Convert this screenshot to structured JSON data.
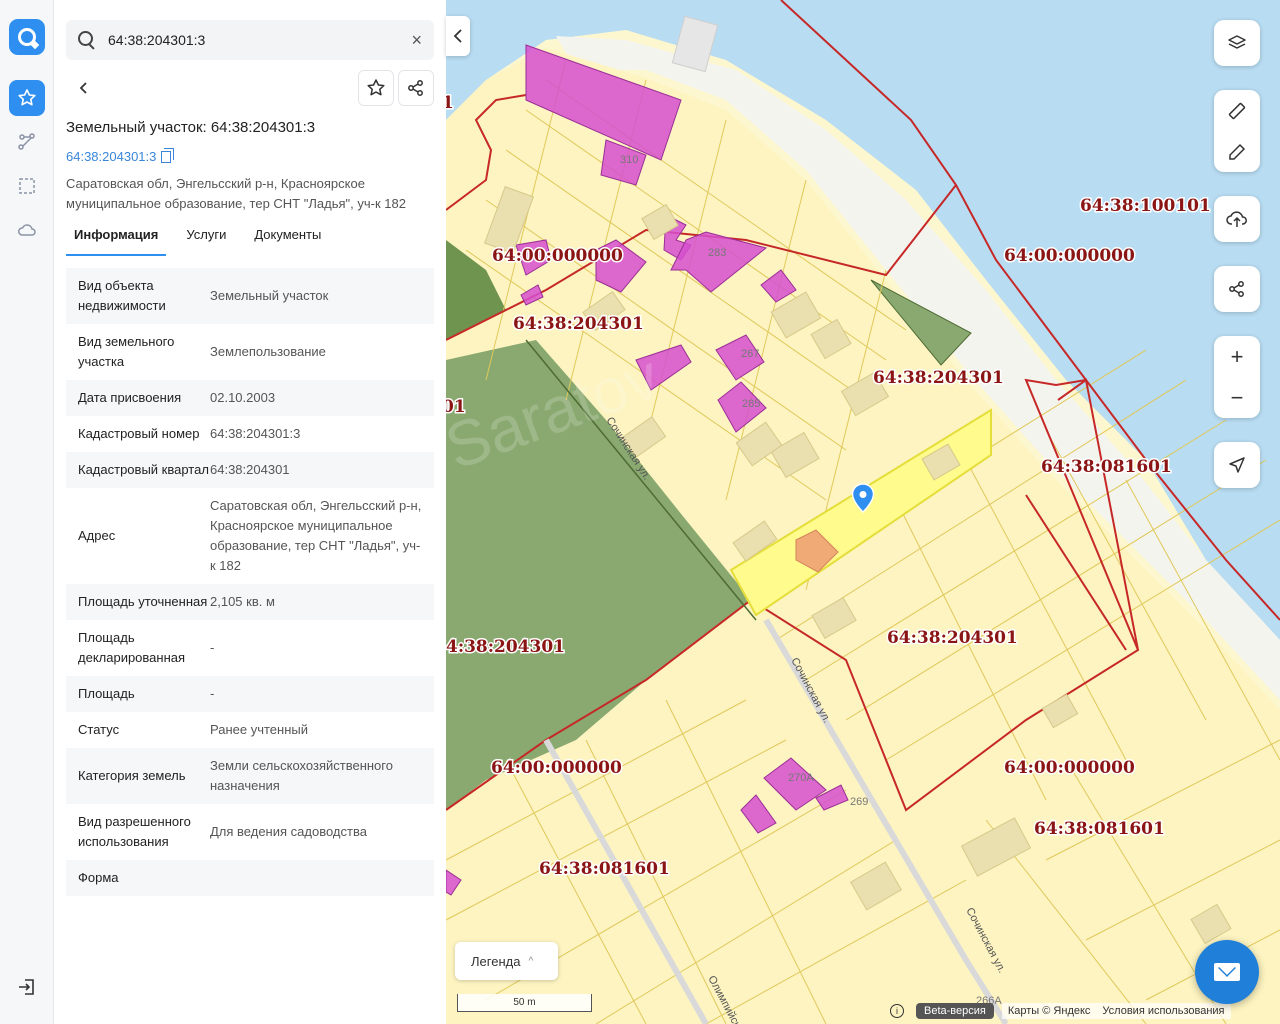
{
  "search": {
    "value": "64:38:204301:3"
  },
  "panel": {
    "title": "Земельный участок: 64:38:204301:3",
    "cad_link": "64:38:204301:3",
    "address": "Саратовская обл, Энгельсский р-н, Красноярское муниципальное образование, тер СНТ \"Ладья\", уч-к 182",
    "tabs": [
      "Информация",
      "Услуги",
      "Документы"
    ],
    "rows": [
      {
        "k": "Вид объекта недвижимости",
        "v": "Земельный участок"
      },
      {
        "k": "Вид земельного участка",
        "v": "Землепользование"
      },
      {
        "k": "Дата присвоения",
        "v": "02.10.2003"
      },
      {
        "k": "Кадастровый номер",
        "v": "64:38:204301:3"
      },
      {
        "k": "Кадастровый квартал",
        "v": "64:38:204301"
      },
      {
        "k": "Адрес",
        "v": "Саратовская обл, Энгельсский р-н, Красноярское муниципальное образование, тер СНТ \"Ладья\", уч-к 182"
      },
      {
        "k": "Площадь уточненная",
        "v": "2,105 кв. м"
      },
      {
        "k": "Площадь декларированная",
        "v": "-"
      },
      {
        "k": "Площадь",
        "v": "-"
      },
      {
        "k": "Статус",
        "v": "Ранее учтенный"
      },
      {
        "k": "Категория земель",
        "v": "Земли сельскохозяйственного назначения"
      },
      {
        "k": "Вид разрешенного использования",
        "v": "Для ведения садоводства"
      },
      {
        "k": "Форма",
        "v": ""
      }
    ]
  },
  "map": {
    "cad_labels": [
      "64:38:100101",
      "64:00:000000",
      "64:38:204301",
      "64:38:081601"
    ],
    "streets": [
      "Сочинская ул.",
      "Олимпийская"
    ],
    "house_numbers": [
      "310",
      "283",
      "267",
      "285",
      "270А",
      "269",
      "266А"
    ],
    "watermark": "Saratov",
    "edge_labels": [
      "1",
      "01",
      "4:38:204301"
    ],
    "legend_label": "Легенда",
    "scale_label": "50 m",
    "beta_label": "Beta-версия",
    "provider": "Карты © Яндекс",
    "terms": "Условия использования"
  },
  "colors": {
    "accent": "#2f8ff0",
    "water": "#b8dcf2",
    "parcel_fill": "#fdf4c1",
    "boundary_red": "#c62828",
    "selected_parcel": "#fffb8c",
    "building_magenta": "#d64fcf",
    "forest": "#8aa970"
  },
  "icons": {
    "rail": [
      "star-icon",
      "route-icon",
      "select-area-icon",
      "cloud-icon"
    ],
    "map_tools": [
      "layers-icon",
      "ruler-icon",
      "edit-icon",
      "upload-icon",
      "share-icon",
      "zoom-in-icon",
      "zoom-out-icon",
      "locate-icon"
    ]
  }
}
